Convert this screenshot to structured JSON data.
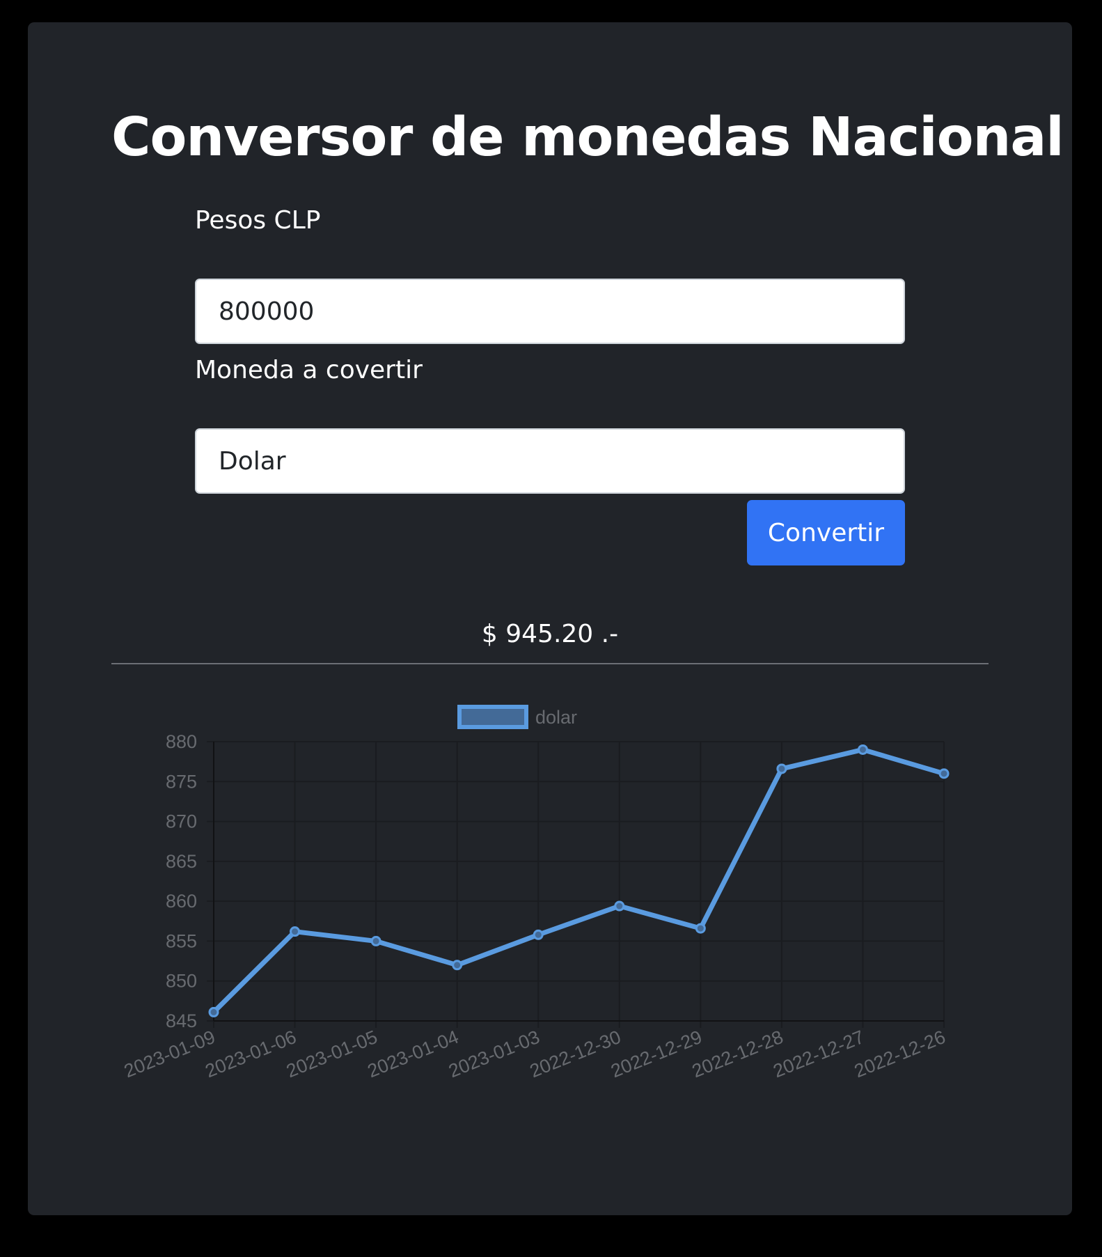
{
  "page": {
    "title": "Conversor de monedas Nacional"
  },
  "form": {
    "amount_label": "Pesos CLP",
    "amount_value": "800000",
    "currency_label": "Moneda a covertir",
    "currency_value": "Dolar",
    "convert_label": "Convertir"
  },
  "result": {
    "text": "$ 945.20 .-"
  },
  "colors": {
    "background": "#000000",
    "card": "#212429",
    "accent_button": "#3173f4",
    "line": "#5a9be0",
    "legend_fill": "#436a97"
  },
  "chart_data": {
    "type": "line",
    "legend_position": "top-center",
    "grid": true,
    "categories": [
      "2023-01-09",
      "2023-01-06",
      "2023-01-05",
      "2023-01-04",
      "2023-01-03",
      "2022-12-30",
      "2022-12-29",
      "2022-12-28",
      "2022-12-27",
      "2022-12-26"
    ],
    "series": [
      {
        "name": "dolar",
        "values": [
          846.1,
          856.2,
          855.0,
          852.0,
          855.8,
          859.4,
          856.6,
          876.6,
          879.0,
          876.0
        ]
      }
    ],
    "yticks": [
      "845",
      "850",
      "855",
      "860",
      "865",
      "870",
      "875",
      "880"
    ],
    "ylim": [
      845,
      880
    ]
  }
}
